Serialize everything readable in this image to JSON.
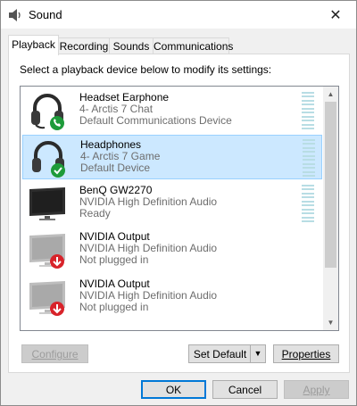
{
  "window": {
    "title": "Sound",
    "close_icon": "close-icon"
  },
  "tabs": [
    {
      "label": "Playback",
      "active": true
    },
    {
      "label": "Recording",
      "active": false
    },
    {
      "label": "Sounds",
      "active": false
    },
    {
      "label": "Communications",
      "active": false
    }
  ],
  "panel": {
    "instruction": "Select a playback device below to modify its settings:"
  },
  "devices": [
    {
      "name": "Headset Earphone",
      "line2": "4- Arctis 7 Chat",
      "line3": "Default Communications Device",
      "icon": "headset-icon",
      "badge": "phone-badge-icon",
      "selected": false
    },
    {
      "name": "Headphones",
      "line2": "4- Arctis 7 Game",
      "line3": "Default Device",
      "icon": "headphones-icon",
      "badge": "check-badge-icon",
      "selected": true
    },
    {
      "name": "BenQ GW2270",
      "line2": "NVIDIA High Definition Audio",
      "line3": "Ready",
      "icon": "monitor-icon",
      "badge": "",
      "selected": false
    },
    {
      "name": "NVIDIA Output",
      "line2": "NVIDIA High Definition Audio",
      "line3": "Not plugged in",
      "icon": "monitor-icon",
      "badge": "unplugged-badge-icon",
      "selected": false
    },
    {
      "name": "NVIDIA Output",
      "line2": "NVIDIA High Definition Audio",
      "line3": "Not plugged in",
      "icon": "monitor-icon",
      "badge": "unplugged-badge-icon",
      "selected": false
    }
  ],
  "buttons": {
    "configure": "Configure",
    "set_default": "Set Default",
    "properties": "Properties",
    "ok": "OK",
    "cancel": "Cancel",
    "apply": "Apply"
  },
  "colors": {
    "selection": "#cce8ff",
    "accent": "#0078d7",
    "badge_green": "#1e9b3a",
    "badge_red": "#d8232a",
    "meter": "#b8dde4"
  }
}
